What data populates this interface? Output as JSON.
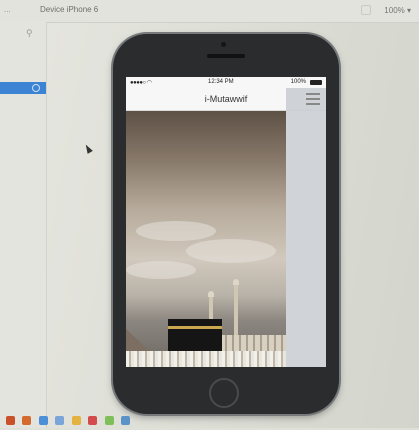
{
  "desktop": {
    "toolbar": {
      "left_label": "...",
      "device_label": "Device  iPhone 6",
      "zoom_label": "100% ▾"
    }
  },
  "app": {
    "status_bar": {
      "signal": "●●●●○ ◠",
      "time": "12:34 PM",
      "battery": "100%"
    },
    "title": "i-Mutawwif"
  },
  "icons": {
    "pin": "pin-icon",
    "menu": "hamburger-menu-icon",
    "battery": "battery-icon",
    "signal": "signal-icon",
    "wifi": "wifi-icon",
    "home": "home-button-icon",
    "cursor": "mouse-pointer-icon"
  },
  "colors": {
    "selection": "#3c83d4",
    "phone_body": "#2b2c2e"
  }
}
